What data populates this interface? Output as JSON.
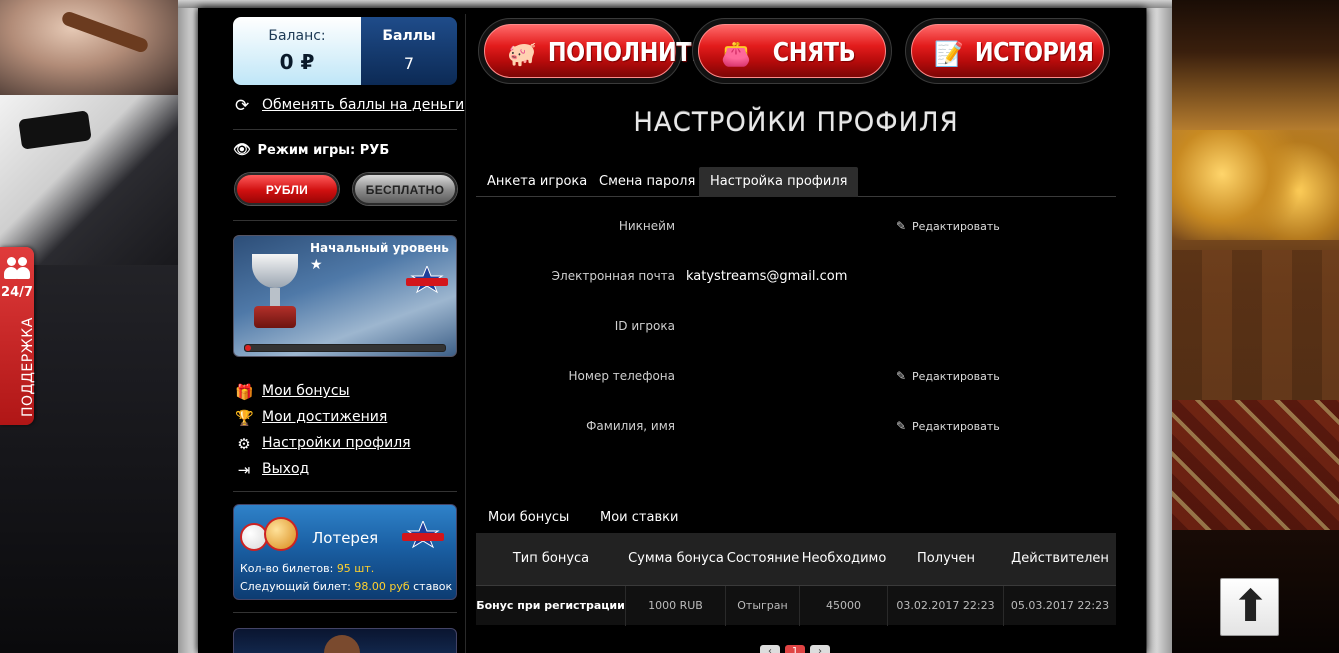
{
  "support": {
    "hours": "24/7",
    "label": "ПОДДЕРЖКА"
  },
  "balance": {
    "label": "Баланс:",
    "value": "0 ₽"
  },
  "points": {
    "label": "Баллы",
    "value": "7"
  },
  "exchange_link": "Обменять баллы на деньги",
  "game_mode": {
    "label": "Режим игры:",
    "value": "РУБ"
  },
  "mode_buttons": {
    "rub": "РУБЛИ",
    "free": "БЕСПЛАТНО"
  },
  "level": {
    "title": "Начальный уровень",
    "progress": 0.03
  },
  "menu": [
    {
      "label": "Мои бонусы",
      "icon": "gift-icon"
    },
    {
      "label": "Мои достижения",
      "icon": "trophy-icon"
    },
    {
      "label": "Настройки профиля",
      "icon": "gear-icon"
    },
    {
      "label": "Выход",
      "icon": "exit-icon"
    }
  ],
  "lottery": {
    "title": "Лотерея",
    "tickets_label": "Кол-во билетов:",
    "tickets_value": "95 шт.",
    "next_label": "Следующий билет:",
    "next_value": "98.00 руб",
    "next_suffix": "ставок"
  },
  "actions": {
    "deposit": "ПОПОЛНИТЬ",
    "withdraw": "СНЯТЬ",
    "history": "ИСТОРИЯ"
  },
  "page_title": "НАСТРОЙКИ ПРОФИЛЯ",
  "tabs": [
    "Анкета игрока",
    "Смена пароля",
    "Настройка профиля"
  ],
  "fields": {
    "nickname": {
      "label": "Никнейм"
    },
    "email": {
      "label": "Электронная почта",
      "value": "katystreams@gmail.com"
    },
    "player_id": {
      "label": "ID игрока"
    },
    "phone": {
      "label": "Номер телефона"
    },
    "fullname": {
      "label": "Фамилия, имя"
    },
    "edit_label": "Редактировать"
  },
  "bonus_tabs": [
    "Мои бонусы",
    "Мои ставки"
  ],
  "bonus_table": {
    "headers": [
      "Тип бонуса",
      "Сумма бонуса",
      "Состояние",
      "Необходимо",
      "Получен",
      "Действителен"
    ],
    "rows": [
      [
        "Бонус при регистрации",
        "1000 RUB",
        "Отыгран",
        "45000",
        "03.02.2017 22:23",
        "05.03.2017 22:23"
      ]
    ]
  },
  "pager": {
    "prev": "‹",
    "current": "1",
    "next": "›"
  },
  "colors": {
    "accent": "#e31c1c",
    "points_bg": "#0c2a55",
    "gold": "#ffd12e"
  }
}
